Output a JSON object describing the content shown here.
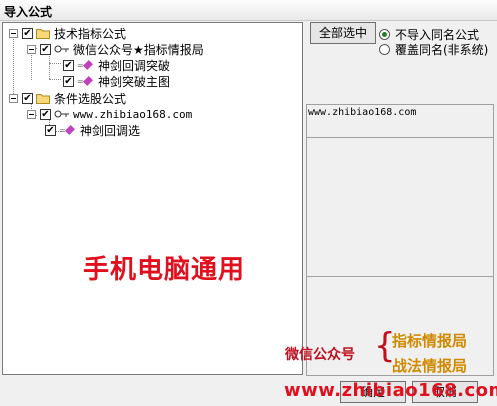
{
  "window": {
    "title": "导入公式"
  },
  "tree": {
    "nodes": [
      {
        "label": "技术指标公式"
      },
      {
        "label": "微信公众号★指标情报局"
      },
      {
        "label": "神剑回调突破"
      },
      {
        "label": "神剑突破主图"
      },
      {
        "label": "条件选股公式"
      },
      {
        "label": "www.zhibiao168.com"
      },
      {
        "label": "神剑回调选"
      }
    ],
    "checkmark": "✔"
  },
  "watermark": "手机电脑通用",
  "right": {
    "select_all": "全部选中",
    "options": [
      {
        "label": "不导入同名公式",
        "selected": true
      },
      {
        "label": "覆盖同名(非系统)",
        "selected": false
      }
    ],
    "info_text": "www.zhibiao168.com"
  },
  "buttons": {
    "ok": "确定",
    "cancel": "取消"
  },
  "ad": {
    "wechat": "微信公众号",
    "brace": "{",
    "line1": "指标情报局",
    "line2": "战法情报局",
    "url": "www.zhibiao168.com"
  },
  "colors": {
    "accent_red": "#e0101f",
    "accent_gold": "#d08a00",
    "radio_on": "#2a7a2a"
  }
}
